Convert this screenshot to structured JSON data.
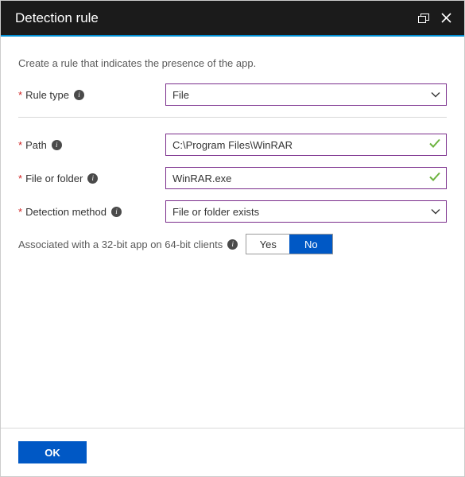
{
  "title": "Detection rule",
  "description": "Create a rule that indicates the presence of the app.",
  "fields": {
    "rule_type": {
      "label": "Rule type",
      "value": "File"
    },
    "path": {
      "label": "Path",
      "value": "C:\\Program Files\\WinRAR"
    },
    "file_or_folder": {
      "label": "File or folder",
      "value": "WinRAR.exe"
    },
    "detection_method": {
      "label": "Detection method",
      "value": "File or folder exists"
    }
  },
  "assoc": {
    "label": "Associated with a 32-bit app on 64-bit clients",
    "yes": "Yes",
    "no": "No",
    "selected": "No"
  },
  "buttons": {
    "ok": "OK"
  }
}
